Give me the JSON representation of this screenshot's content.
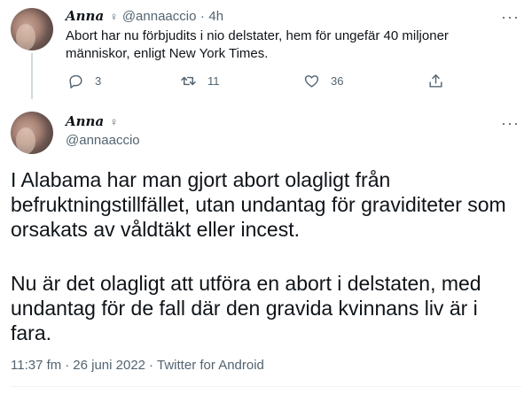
{
  "reply_tweet": {
    "author_name": "Anna",
    "gender_symbol": "♀",
    "handle": "@annaaccio",
    "separator": "·",
    "time": "4h",
    "text": "Abort har nu förbjudits i nio delstater, hem för ungefär 40 miljoner människor, enligt New York Times.",
    "more_label": "···",
    "actions": {
      "reply_count": "3",
      "retweet_count": "11",
      "like_count": "36"
    }
  },
  "main_tweet": {
    "author_name": "Anna",
    "gender_symbol": "♀",
    "handle": "@annaaccio",
    "more_label": "···",
    "paragraph1": "I Alabama har man gjort abort olagligt från befruktningstillfället, utan undantag för graviditeter som orsakats av våldtäkt eller incest.",
    "paragraph2": "Nu är det olagligt att utföra en abort i delstaten, med undantag för de fall där den gravida kvinnans liv är i fara.",
    "time": "11:37 fm",
    "date": "26 juni 2022",
    "source": "Twitter for Android",
    "separator": "·"
  },
  "icons": [
    "reply-icon",
    "retweet-icon",
    "like-icon",
    "share-icon",
    "more-icon"
  ],
  "colors": {
    "text": "#0f1419",
    "secondary": "#536471",
    "line": "#cfd9de"
  }
}
